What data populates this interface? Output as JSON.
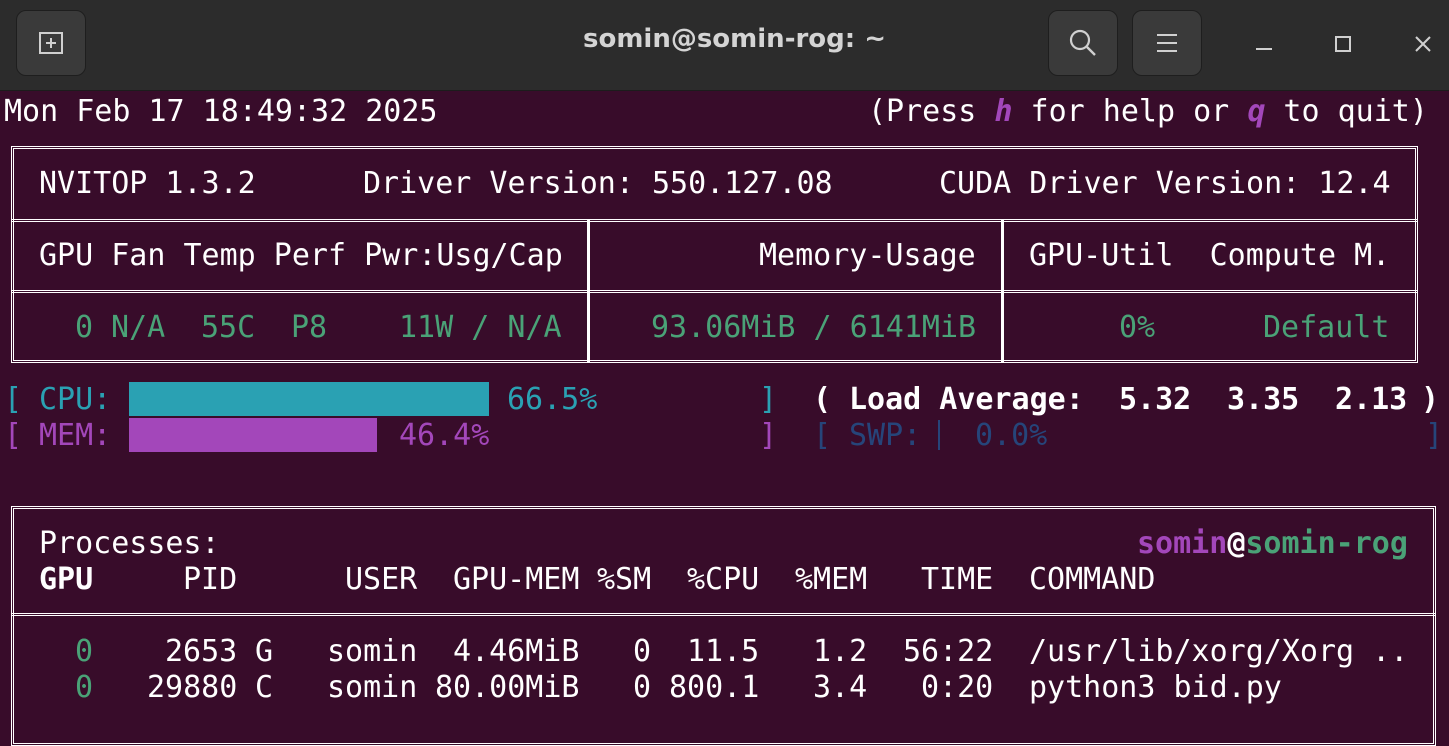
{
  "window": {
    "title": "somin@somin-rog: ~"
  },
  "header": {
    "datetime": "Mon Feb 17 18:49:32 2025",
    "help_pre": "(Press ",
    "help_h": "h",
    "help_mid": " for help or ",
    "help_q": "q",
    "help_post": " to quit)"
  },
  "info": {
    "nvitop": "NVITOP 1.3.2",
    "driver": "Driver Version: 550.127.08",
    "cuda": "CUDA Driver Version: 12.4"
  },
  "gpu_table": {
    "col1_header": "GPU Fan Temp Perf Pwr:Usg/Cap",
    "col2_header": "Memory-Usage",
    "col3_header": "GPU-Util  Compute M.",
    "row": {
      "gpu": "0",
      "fan": "N/A",
      "temp": "55C",
      "perf": "P8",
      "power": "11W / N/A",
      "memory": "93.06MiB / 6141MiB",
      "util": "0%",
      "compute": "Default"
    }
  },
  "meters": {
    "cpu_label": "CPU:",
    "cpu_value": "66.5%",
    "cpu_fraction": 0.665,
    "mem_label": "MEM:",
    "mem_value": "46.4%",
    "mem_fraction": 0.464,
    "load_label": "Load Average:",
    "load_1": "5.32",
    "load_5": "3.35",
    "load_15": "2.13",
    "swp_label": "SWP:",
    "swp_value": "0.0%"
  },
  "processes": {
    "title": "Processes:",
    "user": "somin",
    "at": "@",
    "host": "somin-rog",
    "headers": {
      "gpu": "GPU",
      "pid": "PID",
      "user": "USER",
      "gpu_mem": "GPU-MEM",
      "sm": "%SM",
      "cpu": "%CPU",
      "mem": "%MEM",
      "time": "TIME",
      "command": "COMMAND"
    },
    "rows": [
      {
        "gpu": "0",
        "pid": "2653",
        "type": "G",
        "user": "somin",
        "gpu_mem": "4.46MiB",
        "sm": "0",
        "cpu": "11.5",
        "mem": "1.2",
        "time": "56:22",
        "command": "/usr/lib/xorg/Xorg .."
      },
      {
        "gpu": "0",
        "pid": "29880",
        "type": "C",
        "user": "somin",
        "gpu_mem": "80.00MiB",
        "sm": "0",
        "cpu": "800.1",
        "mem": "3.4",
        "time": "0:20",
        "command": "python3 bid.py"
      }
    ]
  },
  "colors": {
    "background": "#380c2a",
    "titlebar": "#2c2c2c",
    "green": "#4aa277",
    "cyan": "#2aa1b3",
    "magenta": "#a347ba",
    "blue": "#26457a"
  }
}
